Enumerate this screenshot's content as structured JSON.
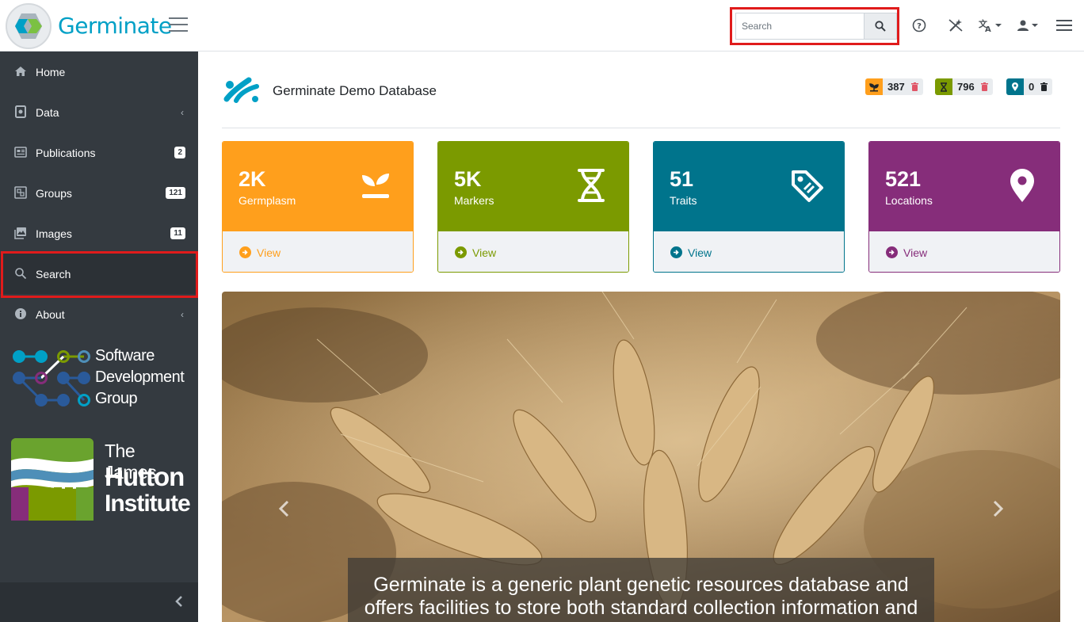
{
  "app": {
    "brand": "Germinate"
  },
  "search": {
    "placeholder": "Search"
  },
  "sidebar": {
    "items": [
      {
        "label": "Home",
        "icon": "home-icon"
      },
      {
        "label": "Data",
        "icon": "database-icon"
      },
      {
        "label": "Publications",
        "icon": "newspaper-icon",
        "badge": "2"
      },
      {
        "label": "Groups",
        "icon": "groups-icon",
        "badge": "121"
      },
      {
        "label": "Images",
        "icon": "images-icon",
        "badge": "11"
      },
      {
        "label": "Search",
        "icon": "search-icon"
      },
      {
        "label": "About",
        "icon": "info-icon"
      }
    ],
    "sdg_lines": [
      "Software",
      "Development",
      "Group"
    ],
    "hutton_lines": [
      "The James",
      "Hutton",
      "Institute"
    ]
  },
  "main": {
    "database_title": "Germinate Demo Database",
    "pills": [
      {
        "icon": "germplasm-icon",
        "count": "387",
        "color": "#ff9f1c"
      },
      {
        "icon": "marker-icon",
        "count": "796",
        "color": "#7b9a00"
      },
      {
        "icon": "location-icon",
        "count": "0",
        "color": "#00748c"
      }
    ],
    "cards": [
      {
        "value": "2K",
        "label": "Germplasm",
        "link": "View",
        "color": "#ff9f1c",
        "icon": "seedling-icon"
      },
      {
        "value": "5K",
        "label": "Markers",
        "link": "View",
        "color": "#7b9a00",
        "icon": "dna-icon"
      },
      {
        "value": "51",
        "label": "Traits",
        "link": "View",
        "color": "#00748c",
        "icon": "tag-icon"
      },
      {
        "value": "521",
        "label": "Locations",
        "link": "View",
        "color": "#862d7a",
        "icon": "map-marker-icon"
      }
    ],
    "carousel_caption": "Germinate is a generic plant genetic resources database and offers facilities to store both standard collection information and"
  }
}
